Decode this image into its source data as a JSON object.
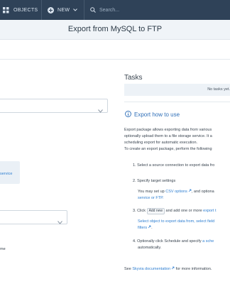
{
  "topbar": {
    "objects_label": "OBJECTS",
    "new_label": "NEW",
    "search_placeholder": "Search..."
  },
  "page": {
    "title": "Export from MySQL to FTP"
  },
  "left": {
    "card_text": "service",
    "fragment_text": "me"
  },
  "tasks": {
    "heading": "Tasks",
    "empty_text": "No tasks yet."
  },
  "howto": {
    "heading": "Export how to use",
    "intro": [
      "Export package allows exporting data from various",
      "optionally upload them to a file storage service. It a",
      "scheduling export for automatic execution.",
      "To create an export package, perform the following"
    ],
    "step1": "1. Select a source connection to export data fro",
    "step2": "2. Specify target settings",
    "step2_pre": "You may set up ",
    "step2_link": "CSV options",
    "step2_mid": ", and optiona",
    "step2_line2": "service or FTP.",
    "step3_pre": "3. Click ",
    "step3_tag": "Add new",
    "step3_mid": " and add one or more ",
    "step3_link": "export t",
    "step3_sub": "Select object to export data from, select field",
    "step3_sub2": "filters",
    "step4_pre": "4. Optionally click Schedule and specify ",
    "step4_link": "a sche",
    "step4_line2": "automatically.",
    "footer_pre": "See ",
    "footer_link": "Skyvia documentation",
    "footer_post": " for more information."
  },
  "colors": {
    "topbar": "#2f4258",
    "link": "#2f7fd1",
    "heading_blue": "#2f6fb8",
    "panel_bg": "#edf2f7"
  },
  "icons": [
    "grid-icon",
    "plus-circle-icon",
    "chevron-down-icon",
    "search-icon",
    "info-icon",
    "external-link-icon"
  ]
}
